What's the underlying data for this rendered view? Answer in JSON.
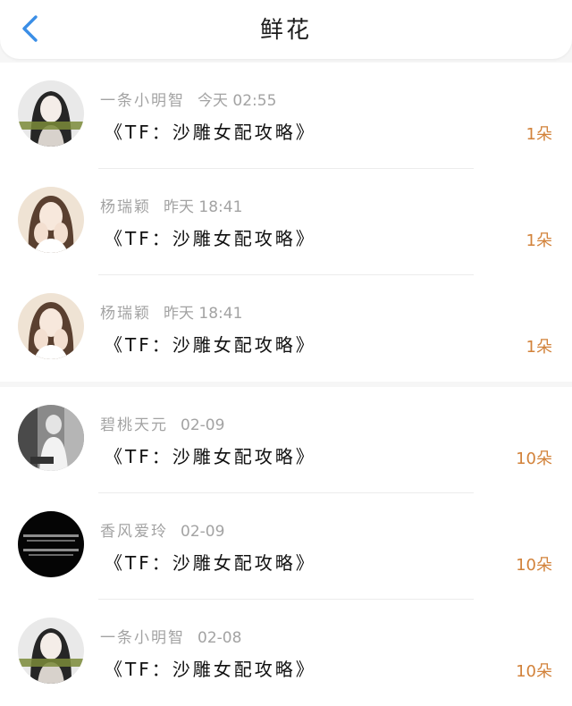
{
  "header": {
    "title": "鲜花",
    "back_icon": "chevron-left-icon",
    "accent_color": "#3a8ee6"
  },
  "colors": {
    "count": "#d2823a",
    "meta": "#a3a3a3",
    "title": "#111111"
  },
  "records": [
    {
      "name": "一条小明智",
      "time": "今天 02:55",
      "book": "《TF：沙雕女配攻略》",
      "count": "1朵",
      "avatar": "avatar-woman-black-hair"
    },
    {
      "name": "杨瑞颖",
      "time": "昨天 18:41",
      "book": "《TF：沙雕女配攻略》",
      "count": "1朵",
      "avatar": "avatar-woman-hands-on-face"
    },
    {
      "name": "杨瑞颖",
      "time": "昨天 18:41",
      "book": "《TF：沙雕女配攻略》",
      "count": "1朵",
      "avatar": "avatar-woman-hands-on-face"
    },
    {
      "name": "碧桃天元",
      "time": "02-09",
      "book": "《TF：沙雕女配攻略》",
      "count": "10朵",
      "avatar": "avatar-man-grayscale"
    },
    {
      "name": "香风爱玲",
      "time": "02-09",
      "book": "《TF：沙雕女配攻略》",
      "count": "10朵",
      "avatar": "avatar-black-text"
    },
    {
      "name": "一条小明智",
      "time": "02-08",
      "book": "《TF：沙雕女配攻略》",
      "count": "10朵",
      "avatar": "avatar-woman-black-hair"
    }
  ]
}
